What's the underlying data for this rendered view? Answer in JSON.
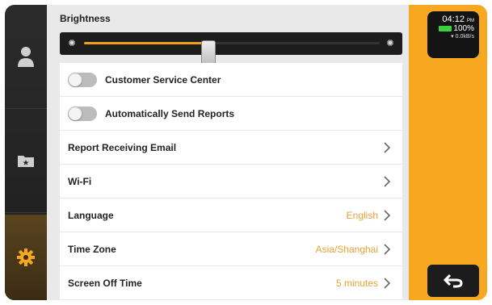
{
  "brightness": {
    "title": "Brightness",
    "level": 0.42
  },
  "settings": [
    {
      "label": "Customer Service Center",
      "type": "toggle",
      "on": false
    },
    {
      "label": "Automatically Send Reports",
      "type": "toggle",
      "on": false
    },
    {
      "label": "Report Receiving Email",
      "type": "nav",
      "value": ""
    },
    {
      "label": "Wi-Fi",
      "type": "nav",
      "value": ""
    },
    {
      "label": "Language",
      "type": "nav",
      "value": "English"
    },
    {
      "label": "Time Zone",
      "type": "nav",
      "value": "Asia/Shanghai"
    },
    {
      "label": "Screen Off Time",
      "type": "nav",
      "value": "5 minutes"
    }
  ],
  "status": {
    "time": "04:12",
    "ampm": "PM",
    "battery": "100%",
    "network": "0.0kB/s"
  },
  "sidebar": {
    "items": [
      "user-icon",
      "folder-star-icon",
      "gear-icon"
    ]
  },
  "colors": {
    "accent": "#f7a820",
    "value_text": "#e8a133",
    "dark": "#1e1e1e"
  }
}
